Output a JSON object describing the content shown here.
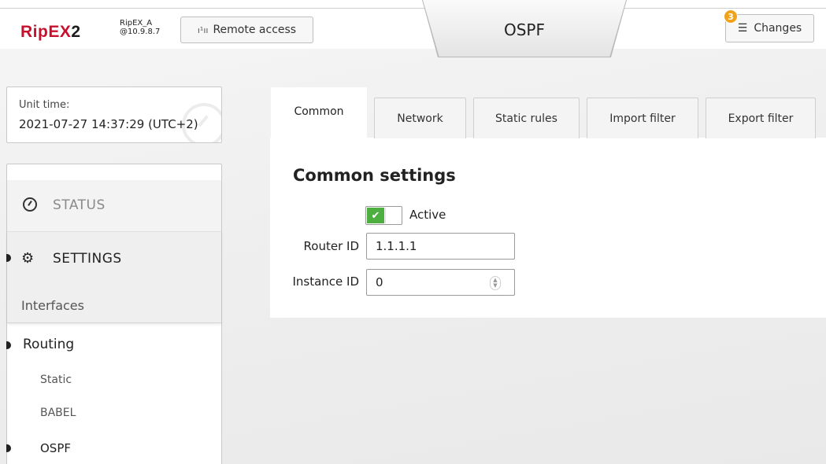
{
  "header": {
    "logo_main": "RipEX",
    "logo_suffix": "2",
    "unit_name": "RipEX_A",
    "unit_ip": "@10.9.8.7",
    "remote_access_label": "Remote access",
    "page_title": "OSPF",
    "changes_label": "Changes",
    "changes_count": "3",
    "brand_color": "#c8102e",
    "badge_color": "#f0a21b"
  },
  "unit_time": {
    "label": "Unit time:",
    "value": "2021-07-27 14:37:29 (UTC+2)"
  },
  "menu": {
    "status": "STATUS",
    "settings": "SETTINGS",
    "interfaces": "Interfaces",
    "routing": "Routing",
    "static": "Static",
    "babel": "BABEL",
    "ospf": "OSPF"
  },
  "tabs": [
    {
      "label": "Common",
      "active": true
    },
    {
      "label": "Network",
      "active": false
    },
    {
      "label": "Static rules",
      "active": false
    },
    {
      "label": "Import filter",
      "active": false
    },
    {
      "label": "Export filter",
      "active": false
    }
  ],
  "form": {
    "section_title": "Common settings",
    "active_label": "Active",
    "active_value": true,
    "router_id_label": "Router ID",
    "router_id_value": "1.1.1.1",
    "instance_id_label": "Instance ID",
    "instance_id_value": "0",
    "toggle_color": "#4caf3f"
  }
}
